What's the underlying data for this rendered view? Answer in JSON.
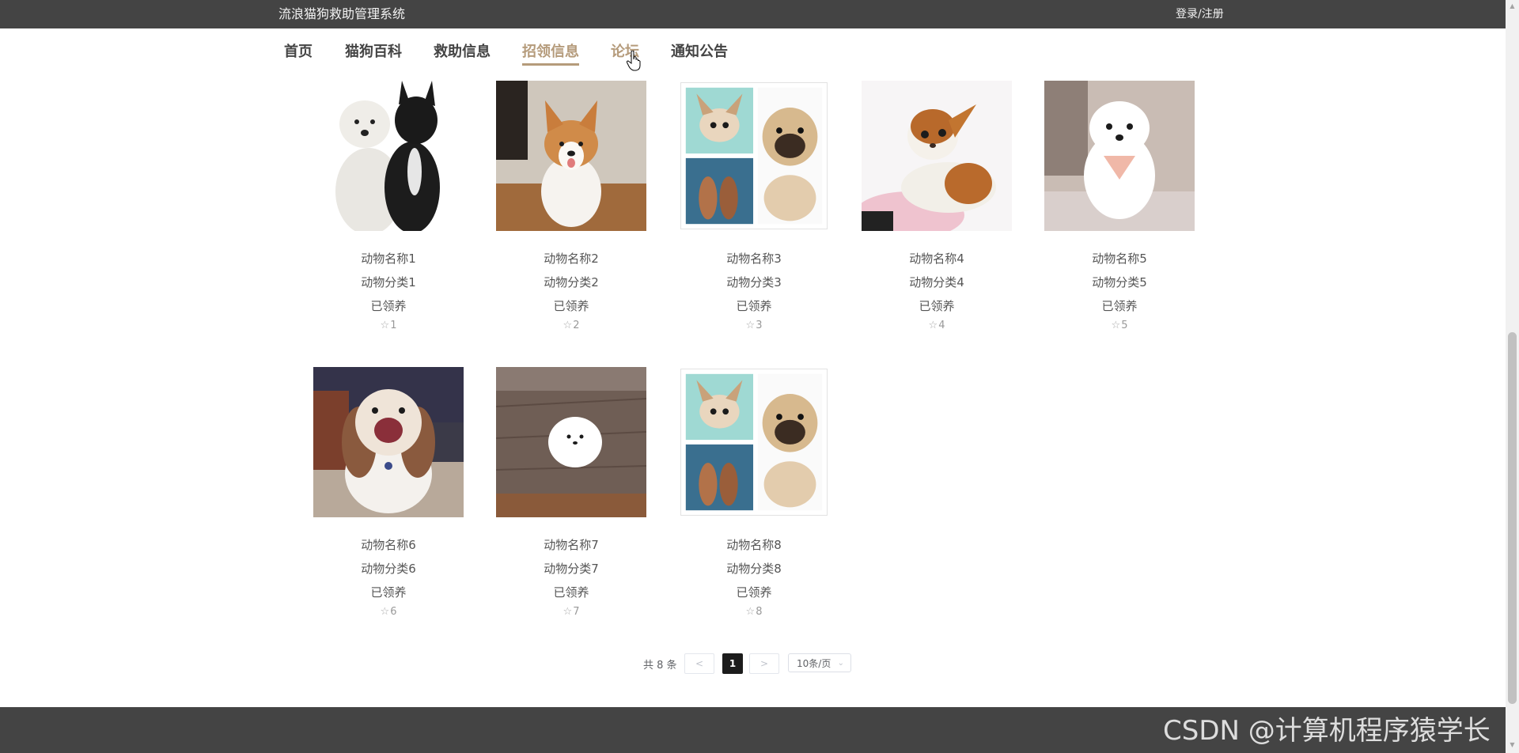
{
  "header": {
    "site_title": "流浪猫狗救助管理系统",
    "login_label": "登录/注册"
  },
  "nav": {
    "items": [
      {
        "label": "首页"
      },
      {
        "label": "猫狗百科"
      },
      {
        "label": "救助信息"
      },
      {
        "label": "招领信息",
        "active": true
      },
      {
        "label": "论坛",
        "hovered": true
      },
      {
        "label": "通知公告"
      }
    ]
  },
  "cards": [
    {
      "name": "动物名称1",
      "category": "动物分类1",
      "status": "已领养",
      "likes": "1",
      "photo": "two-dogs-white-black"
    },
    {
      "name": "动物名称2",
      "category": "动物分类2",
      "status": "已领养",
      "likes": "2",
      "photo": "corgi-puppy"
    },
    {
      "name": "动物名称3",
      "category": "动物分类3",
      "status": "已领养",
      "likes": "3",
      "photo": "collage-chihuahua-pug"
    },
    {
      "name": "动物名称4",
      "category": "动物分类4",
      "status": "已领养",
      "likes": "4",
      "photo": "chihuahua-puppy"
    },
    {
      "name": "动物名称5",
      "category": "动物分类5",
      "status": "已领养",
      "likes": "5",
      "photo": "white-pomeranian"
    },
    {
      "name": "动物名称6",
      "category": "动物分类6",
      "status": "已领养",
      "likes": "6",
      "photo": "shih-tzu"
    },
    {
      "name": "动物名称7",
      "category": "动物分类7",
      "status": "已领养",
      "likes": "7",
      "photo": "white-puppy-on-deck"
    },
    {
      "name": "动物名称8",
      "category": "动物分类8",
      "status": "已领养",
      "likes": "8",
      "photo": "collage-chihuahua-pug"
    }
  ],
  "pagination": {
    "total_text": "共 8 条",
    "prev": "<",
    "current": "1",
    "next": ">",
    "page_size": "10条/页"
  },
  "watermark": "CSDN @计算机程序猿学长",
  "icons": {
    "star": "star-outline-icon",
    "cursor": "hand-pointer-icon"
  },
  "colors": {
    "header_bg": "#444444",
    "accent": "#b59b7b",
    "active_page": "#1c1c1c"
  }
}
